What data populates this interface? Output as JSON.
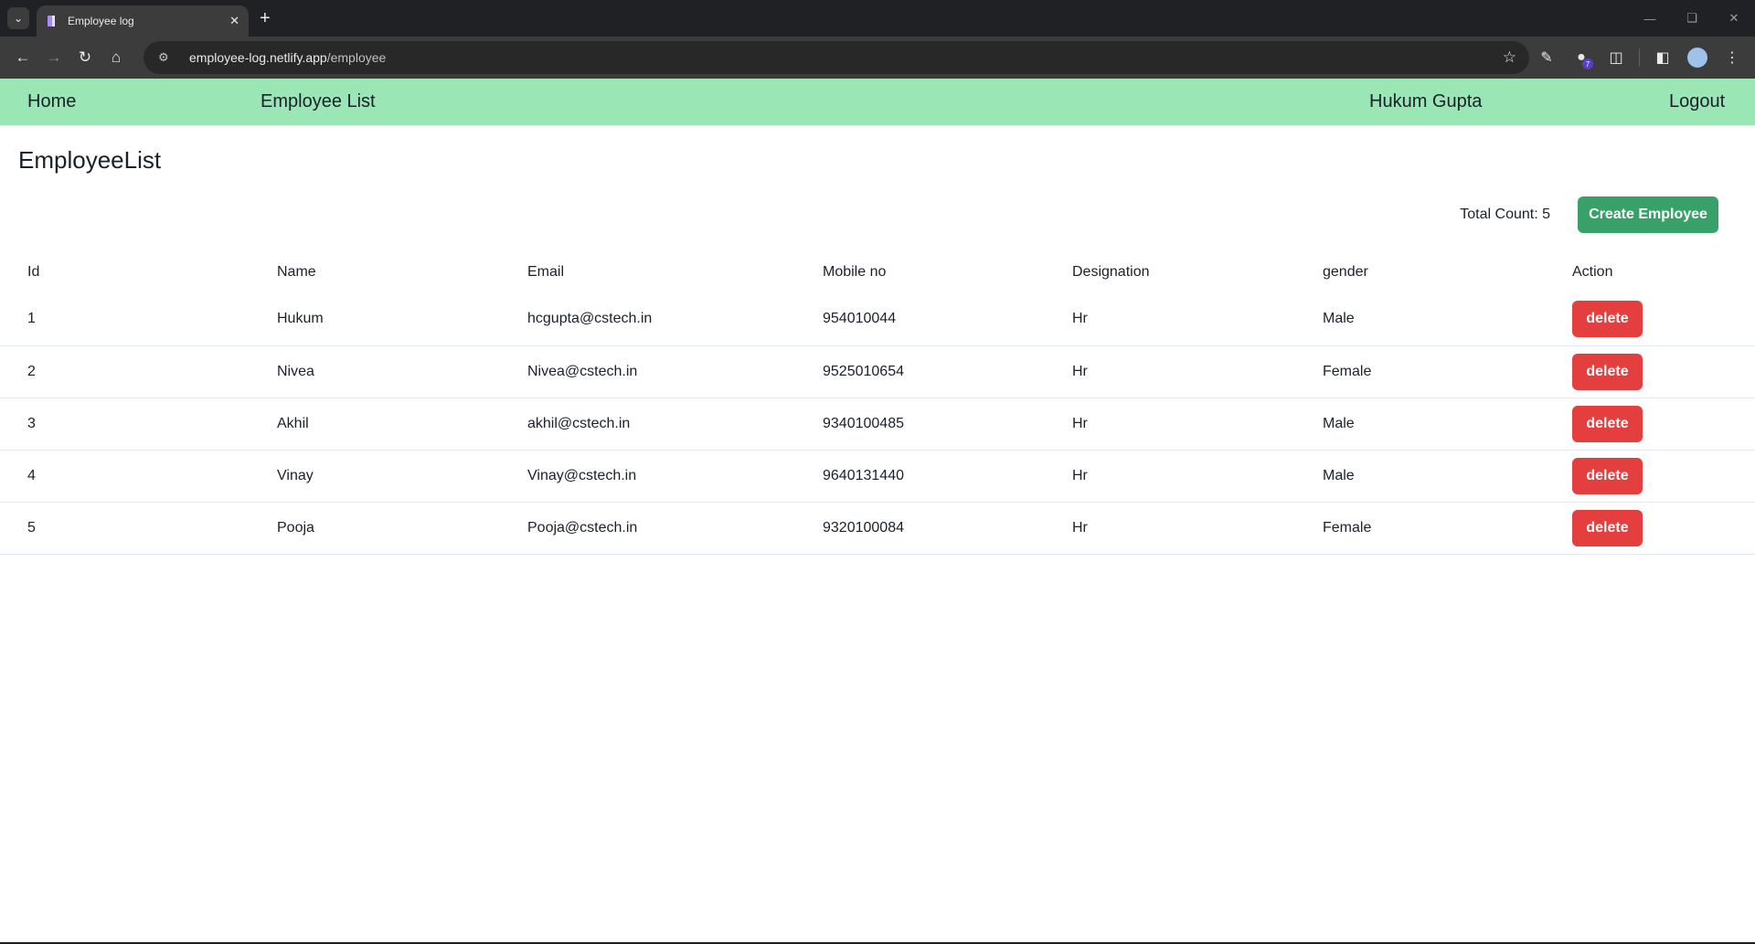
{
  "browser": {
    "tab_title": "Employee log",
    "url_host": "employee-log.netlify.app",
    "url_path": "/employee",
    "extension_badge": "7"
  },
  "nav": {
    "home": "Home",
    "employee_list": "Employee List",
    "user_name": "Hukum Gupta",
    "logout": "Logout"
  },
  "page": {
    "title": "EmployeeList",
    "total_count": "Total Count: 5",
    "create_button": "Create Employee"
  },
  "table": {
    "headers": [
      "Id",
      "Name",
      "Email",
      "Mobile no",
      "Designation",
      "gender",
      "Action"
    ],
    "delete_label": "delete",
    "rows": [
      {
        "id": "1",
        "name": "Hukum",
        "email": "hcgupta@cstech.in",
        "mobile": "954010044",
        "designation": "Hr",
        "gender": "Male"
      },
      {
        "id": "2",
        "name": "Nivea",
        "email": "Nivea@cstech.in",
        "mobile": "9525010654",
        "designation": "Hr",
        "gender": "Female"
      },
      {
        "id": "3",
        "name": "Akhil",
        "email": "akhil@cstech.in",
        "mobile": "9340100485",
        "designation": "Hr",
        "gender": "Male"
      },
      {
        "id": "4",
        "name": "Vinay",
        "email": "Vinay@cstech.in",
        "mobile": "9640131440",
        "designation": "Hr",
        "gender": "Male"
      },
      {
        "id": "5",
        "name": "Pooja",
        "email": "Pooja@cstech.in",
        "mobile": "9320100084",
        "designation": "Hr",
        "gender": "Female"
      }
    ]
  },
  "colors": {
    "nav_bg": "#9ae6b4",
    "create_button": "#38a169",
    "delete_button": "#e53e3e"
  }
}
